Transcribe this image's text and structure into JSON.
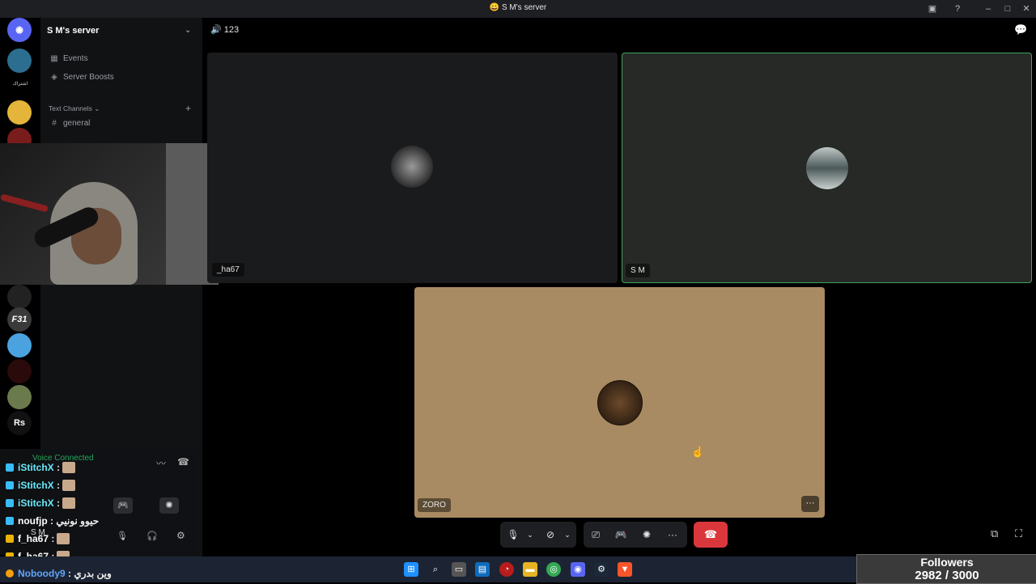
{
  "window": {
    "title": "S M's server"
  },
  "server": {
    "name": "S M's server"
  },
  "sidebar": {
    "events_label": "Events",
    "boosts_label": "Server Boosts",
    "text_channels_label": "Text Channels",
    "channels": [
      "general"
    ],
    "server_icon_labels": [
      "F31",
      "Rs"
    ],
    "server_label_arabic": "اشتراك"
  },
  "voice": {
    "channel_name": "123",
    "connected_label": "Voice Connected",
    "current_user_label": "S M"
  },
  "participants": [
    {
      "name": "_ha67",
      "speaking": false
    },
    {
      "name": "S M",
      "speaking": true
    },
    {
      "name": "ZORO",
      "speaking": false
    }
  ],
  "chat_overlay": [
    {
      "user": "iStitchX",
      "text": ":"
    },
    {
      "user": "iStitchX",
      "text": ":"
    },
    {
      "user": "iStitchX",
      "text": ":"
    },
    {
      "user": "noufjp",
      "text": ": حيوو نونيي"
    },
    {
      "user": "f_ha67",
      "text": ":"
    },
    {
      "user": "f_ha67",
      "text": ":"
    },
    {
      "user": "Noboody9",
      "text": ": وين بدري"
    }
  ],
  "followers": {
    "label": "Followers",
    "count": "2982 / 3000",
    "progress": 0.994
  },
  "colors": {
    "leave": "#da373c",
    "speaking": "#3ba55c",
    "zoro_bg": "#a88b62",
    "accent": "#5865f2"
  }
}
